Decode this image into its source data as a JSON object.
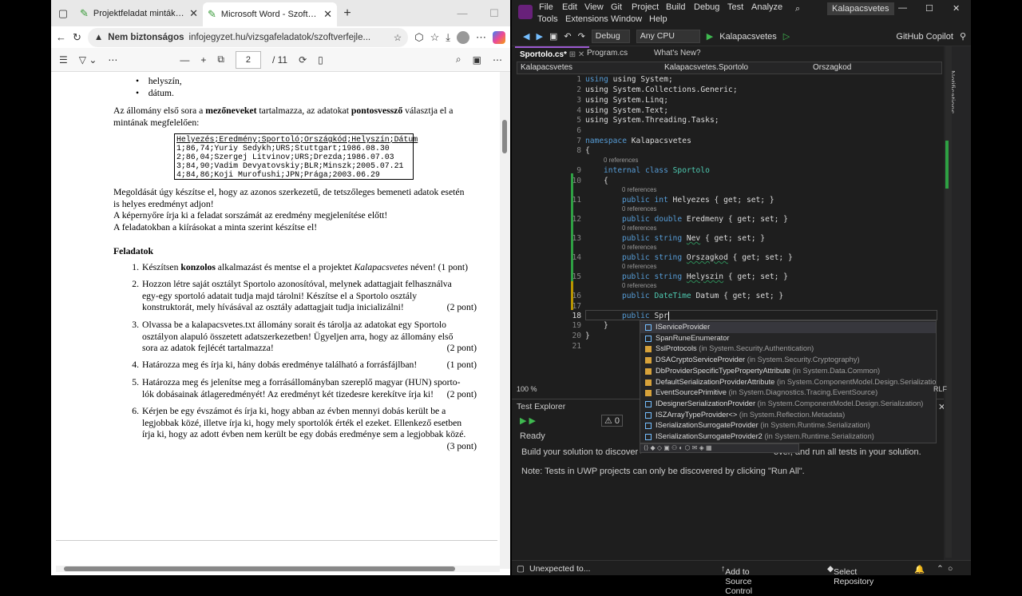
{
  "browser": {
    "tabs": [
      {
        "title": "Projektfeladat minták - Szoftverfe"
      },
      {
        "title": "Microsoft Word - Szoftverfejl_Proj"
      }
    ],
    "security_label": "Nem biztonságos",
    "url": "infojegyzet.hu/vizsgafeladatok/szoftverfejle...",
    "pdf": {
      "page": "2",
      "total": "/ 11"
    }
  },
  "doc": {
    "bullets": [
      "helyszín,",
      "dátum."
    ],
    "intro1_a": "Az állomány első sora a ",
    "intro1_b": "mezőneveket",
    "intro1_c": " tartalmazza, az adatokat ",
    "intro1_d": "pontosvessző",
    "intro1_e": " választja el a",
    "intro1_f": "mintának megfelelően:",
    "sample": [
      "Helyezés;Eredmény;Sportoló;Országkód;Helyszín;Dátum",
      "1;86,74;Yuriy Sedykh;URS;Stuttgart;1986.08.30",
      "2;86,04;Szergej Litvinov;URS;Drezda;1986.07.03",
      "3;84,90;Vadim Devyatovskiy;BLR;Minszk;2005.07.21",
      "4;84,86;Koji Murofushi;JPN;Prága;2003.06.29"
    ],
    "p2": "Megoldását úgy készítse el, hogy az azonos szerkezetű, de tetszőleges bemeneti adatok esetén",
    "p2b": "is helyes eredményt adjon!",
    "p3": "A képernyőre írja ki a feladat sorszámát az eredmény megjelenítése előtt!",
    "p4": "A feladatokban a kiírásokat a minta szerint készítse el!",
    "heading": "Feladatok",
    "tasks": [
      {
        "n": "1.",
        "l1a": "Készítsen ",
        "l1b": "konzolos",
        "l1c": " alkalmazást és mentse el a projektet ",
        "l1d": "Kalapacsvetes",
        "l1e": " néven! (1 pont)"
      },
      {
        "n": "2.",
        "l1": "Hozzon létre saját osztályt Sportolo azonosítóval, melynek adattagjait felhasználva",
        "l2": "egy-egy sportoló adatait tudja majd tárolni! Készítse el a Sportolo osztály",
        "l3": "konstruktorát, mely hívásával az osztály adattagjait tudja inicializálni!",
        "pt": "(2 pont)"
      },
      {
        "n": "3.",
        "l1": "Olvassa be a kalapacsvetes.txt állomány sorait és tárolja az adatokat egy Sportolo",
        "l2": "osztályon alapuló összetett adatszerkezetben! Ügyeljen arra, hogy az állomány első",
        "l3": "sora az adatok fejlécét tartalmazza!",
        "pt": "(2 pont)"
      },
      {
        "n": "4.",
        "l1": "Határozza meg és írja ki, hány dobás eredménye található a forrásfájlban!",
        "pt": "(1 pont)"
      },
      {
        "n": "5.",
        "l1": "Határozza meg és jelenítse meg a forrásállományban szereplő magyar (HUN) sporto-",
        "l2": "lók dobásainak átlageredményét! Az eredményt két tizedesre kerekítve írja ki!",
        "pt": "(2 pont)"
      },
      {
        "n": "6.",
        "l1": "Kérjen be egy évszámot és írja ki, hogy abban az évben mennyi dobás került be a",
        "l2": "legjobbak közé, illetve írja ki, hogy mely sportolók érték el ezeket. Ellenkező esetben",
        "l3": "írja ki, hogy az adott évben nem került be egy dobás eredménye sem a legjobbak közé.",
        "pt": "(3 pont)"
      }
    ]
  },
  "vs": {
    "menu": [
      "File",
      "Edit",
      "View",
      "Git",
      "Project",
      "Build",
      "Debug",
      "Test",
      "Analyze",
      "Tools",
      "Extensions",
      "Window",
      "Help"
    ],
    "solution": "Kalapacsvetes",
    "config": "Debug",
    "platform": "Any CPU",
    "run_target": "Kalapacsvetes",
    "copilot": "GitHub Copilot",
    "tabs": [
      "Sportolo.cs*",
      "Program.cs",
      "What's New?"
    ],
    "nav": {
      "project": "Kalapacsvetes",
      "class": "Kalapacsvetes.Sportolo",
      "member": "Orszagkod"
    },
    "refs": "0 references",
    "code": {
      "l1": "using System;",
      "l2": "using System.Collections.Generic;",
      "l3": "using System.Linq;",
      "l4": "using System.Text;",
      "l5": "using System.Threading.Tasks;",
      "ns_kw": "namespace",
      "ns_name": "Kalapacsvetes",
      "cls_kw": "internal class",
      "cls_name": "Sportolo",
      "props": [
        {
          "t": "int",
          "n": "Helyezes"
        },
        {
          "t": "double",
          "n": "Eredmeny"
        },
        {
          "t": "string",
          "n": "Nev"
        },
        {
          "t": "string",
          "n": "Orszagkod"
        },
        {
          "t": "string",
          "n": "Helyszin"
        },
        {
          "t": "DateTime",
          "n": "Datum"
        }
      ],
      "pub": "public",
      "getset": "{ get; set; }",
      "typing": "Spr"
    },
    "intellisense": [
      {
        "name": "IServiceProvider",
        "ns": ""
      },
      {
        "name": "SpanRuneEnumerator",
        "ns": ""
      },
      {
        "name": "SslProtocols",
        "ns": "(in System.Security.Authentication)"
      },
      {
        "name": "DSACryptoServiceProvider",
        "ns": "(in System.Security.Cryptography)"
      },
      {
        "name": "DbProviderSpecificTypePropertyAttribute",
        "ns": "(in System.Data.Common)"
      },
      {
        "name": "DefaultSerializationProviderAttribute",
        "ns": "(in System.ComponentModel.Design.Serialization)"
      },
      {
        "name": "EventSourcePrimitive",
        "ns": "(in System.Diagnostics.Tracing.EventSource)"
      },
      {
        "name": "IDesignerSerializationProvider",
        "ns": "(in System.ComponentModel.Design.Serialization)"
      },
      {
        "name": "ISZArrayTypeProvider<>",
        "ns": "(in System.Reflection.Metadata)"
      },
      {
        "name": "ISerializationSurrogateProvider",
        "ns": "(in System.Runtime.Serialization)"
      },
      {
        "name": "ISerializationSurrogateProvider2",
        "ns": "(in System.Runtime.Serialization)"
      }
    ],
    "zoom": "100 %",
    "test": {
      "title": "Test Explorer",
      "count": "0",
      "ready": "Ready",
      "msg1": "Build your solution to discover all av",
      "msg1b": "over, and run all tests in your solution.",
      "msg2": "Note: Tests in UWP projects can only be discovered by clicking \"Run All\"."
    },
    "status": {
      "left": "Unexpected to...",
      "source": "Add to Source Control",
      "repo": "Select Repository",
      "lf": "RLF"
    },
    "notifications": "Notifications"
  }
}
